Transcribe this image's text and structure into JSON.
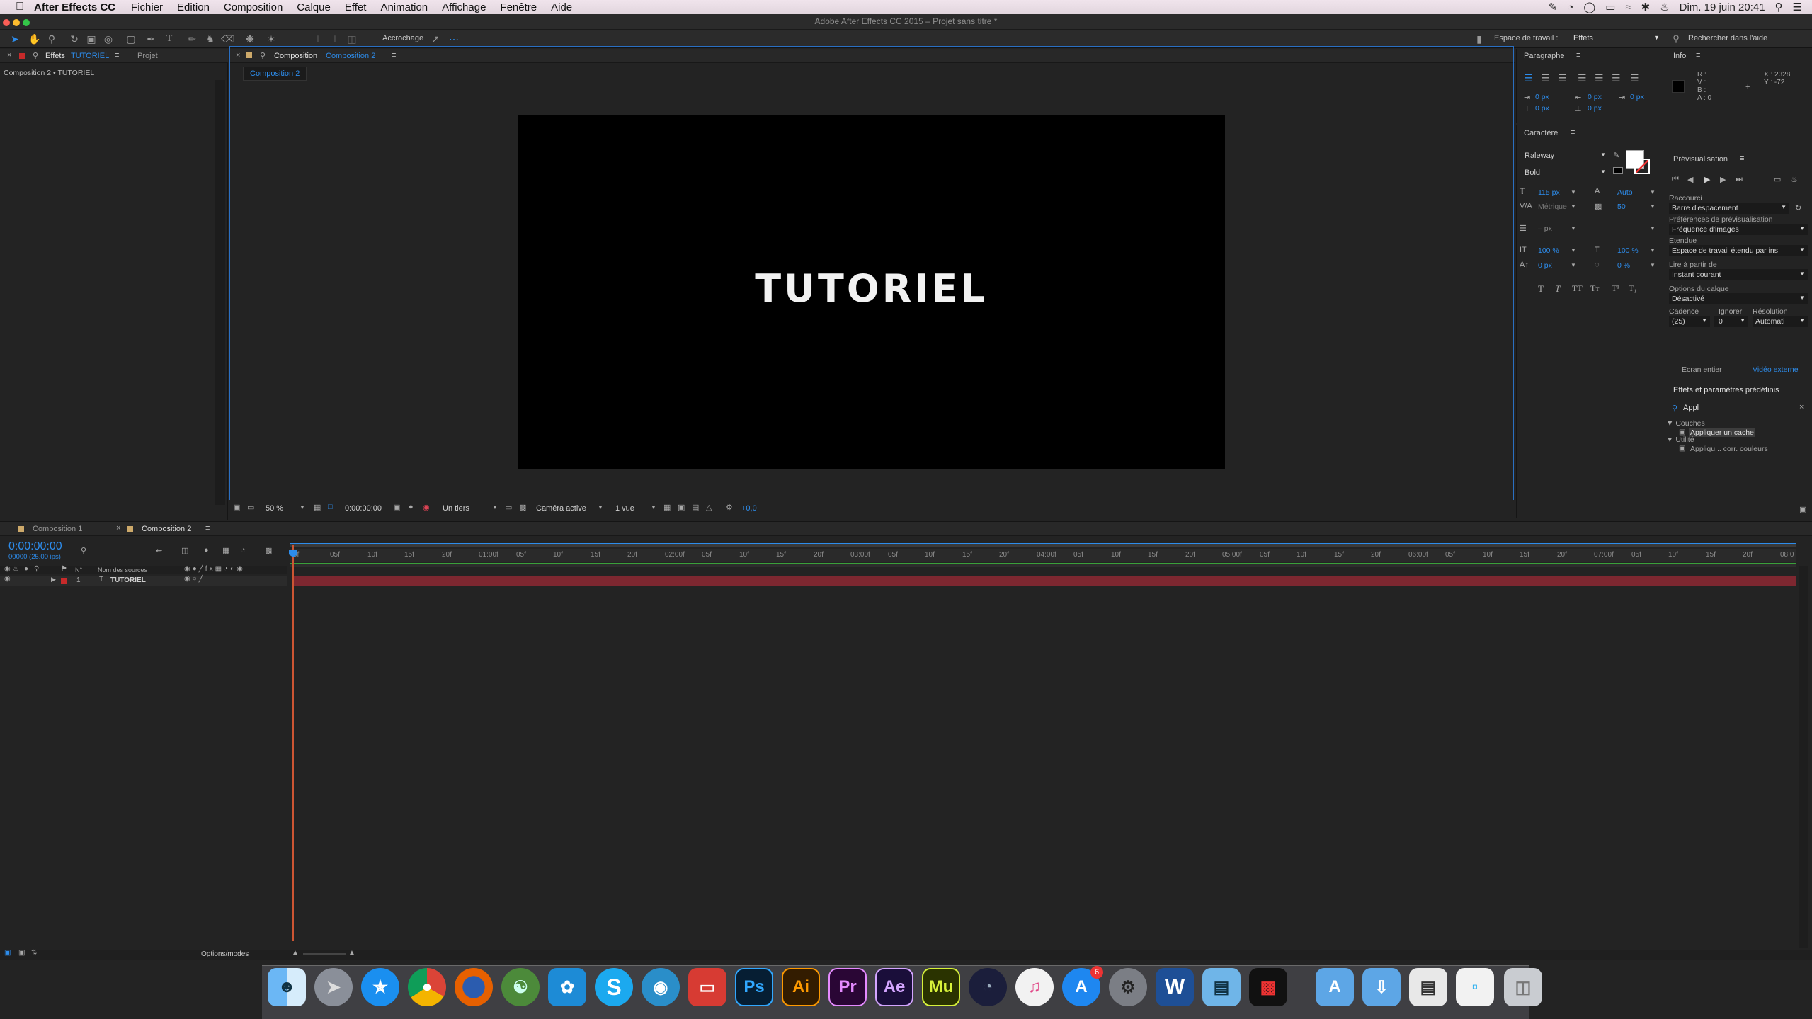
{
  "menubar": {
    "app": "After Effects CC",
    "items": [
      "Fichier",
      "Edition",
      "Composition",
      "Calque",
      "Effet",
      "Animation",
      "Affichage",
      "Fenêtre",
      "Aide"
    ],
    "datetime": "Dim. 19 juin  20:41"
  },
  "window_title": "Adobe After Effects CC 2015 – Projet sans titre *",
  "toolbar": {
    "snapping": "Accrochage",
    "workspace_label": "Espace de travail :",
    "workspace_value": "Effets",
    "search_help": "Rechercher dans l'aide"
  },
  "effects_panel": {
    "tab_effects": "Effets",
    "tab_effects_layer": "TUTORIEL",
    "tab_project": "Projet",
    "breadcrumb": "Composition 2 • TUTORIEL"
  },
  "composition_panel": {
    "tab_label": "Composition",
    "tab_comp": "Composition 2",
    "subtab": "Composition 2",
    "canvas_text": "TUTORIEL",
    "footer": {
      "zoom": "50 %",
      "timecode": "0:00:00:00",
      "resolution": "Un tiers",
      "camera": "Caméra active",
      "views": "1 vue",
      "exposure": "+0,0"
    }
  },
  "paragraph_panel": {
    "title": "Paragraphe",
    "indent_left": "0 px",
    "indent_right": "0 px",
    "space_before": "0 px",
    "space_after": "0 px",
    "indent_first": "0 px"
  },
  "character_panel": {
    "title": "Caractère",
    "font": "Raleway",
    "style": "Bold",
    "size": "115 px",
    "leading": "Auto",
    "kerning": "Métrique",
    "tracking": "50",
    "stroke_width": "– px",
    "vscale": "100 %",
    "hscale": "100 %",
    "baseline": "0 px",
    "tsume": "0 %"
  },
  "info_panel": {
    "title": "Info",
    "r": "R :",
    "v": "V :",
    "b": "B :",
    "a": "A : 0",
    "x": "X : 2328",
    "y": "Y : -72"
  },
  "preview_panel": {
    "title": "Prévisualisation",
    "shortcut_label": "Raccourci",
    "shortcut_value": "Barre d'espacement",
    "prefs_label": "Préférences de prévisualisation",
    "prefs_value": "Fréquence d'images",
    "range_label": "Etendue",
    "range_value": "Espace de travail étendu par ins",
    "play_from_label": "Lire à partir de",
    "play_from_value": "Instant courant",
    "layer_options_label": "Options du calque",
    "layer_options_value": "Désactivé",
    "cadence_label": "Cadence",
    "skip_label": "Ignorer",
    "resolution_label": "Résolution",
    "cadence_value": "(25)",
    "skip_value": "0",
    "resolution_value": "Automati",
    "fullscreen": "Ecran entier",
    "external_video": "Vidéo externe"
  },
  "effects_presets": {
    "title": "Effets et paramètres prédéfinis",
    "search": "Appl",
    "categories": [
      {
        "name": "Couches",
        "items": [
          "Appliquer un cache"
        ]
      },
      {
        "name": "Utilité",
        "items": [
          "Appliqu... corr. couleurs"
        ]
      }
    ]
  },
  "timeline": {
    "tabs": [
      "Composition 1",
      "Composition 2"
    ],
    "timecode": "0:00:00:00",
    "fps": "00000 (25.00 ips)",
    "col_num": "N°",
    "col_source": "Nom des sources",
    "layer_num": "1",
    "layer_name": "TUTORIEL",
    "ruler": [
      "0f",
      "05f",
      "10f",
      "15f",
      "20f",
      "01:00f",
      "05f",
      "10f",
      "15f",
      "20f",
      "02:00f",
      "05f",
      "10f",
      "15f",
      "20f",
      "03:00f",
      "05f",
      "10f",
      "15f",
      "20f",
      "04:00f",
      "05f",
      "10f",
      "15f",
      "20f",
      "05:00f",
      "05f",
      "10f",
      "15f",
      "20f",
      "06:00f",
      "05f",
      "10f",
      "15f",
      "20f",
      "07:00f",
      "05f",
      "10f",
      "15f",
      "20f",
      "08:0"
    ],
    "toggle_label": "Options/modes"
  },
  "dock": {
    "apps": [
      "Finder",
      "Launchpad",
      "Safari",
      "Chrome",
      "Firefox",
      "Jeu",
      "Twitter",
      "Skype",
      "Sécurité",
      "Remote",
      "Ps",
      "Ai",
      "Pr",
      "Ae",
      "Mu",
      "Cinema 4D",
      "iTunes",
      "App Store",
      "Préférences Système",
      "Word",
      "Aperçu",
      "Stats",
      "Applications",
      "Téléchargements",
      "Documents",
      "Fichiers",
      "Corbeille"
    ],
    "appstore_badge": "6"
  }
}
